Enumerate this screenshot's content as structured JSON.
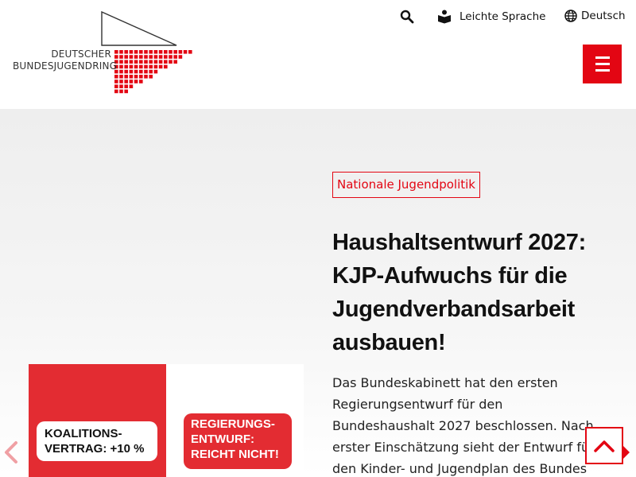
{
  "header": {
    "logo_line1": "DEUTSCHER",
    "logo_line2": "BUNDESJUGENDRING",
    "search_icon": "search-icon",
    "easy_language_label": "Leichte Sprache",
    "easy_language_icon": "book-reader-icon",
    "language_label": "Deutsch",
    "language_icon": "globe-icon",
    "menu_icon": "hamburger-icon"
  },
  "hero": {
    "category": "Nationale Jugendpolitik",
    "headline": "Haushaltsentwurf 2027: KJP-Aufwuchs für die Jugendverbandsarbeit ausbauen!",
    "teaser": "Das Bundeskabinett hat den ersten Regierungsentwurf für den Bundeshaushalt 2027 beschlossen. Nach erster Einschätzung sieht der Entwurf für den Kinder- und Jugendplan des Bundes",
    "image": {
      "sticker_left_line1": "KOALITIONS-",
      "sticker_left_line2": "VERTRAG: +10 %",
      "sticker_right_line1": "REGIERUNGS-",
      "sticker_right_line2": "ENTWURF:",
      "sticker_right_line3": "REICHT NICHT!"
    }
  },
  "controls": {
    "prev_icon": "chevron-left-icon",
    "next_icon": "chevron-right-icon",
    "back_to_top_icon": "chevron-up-icon"
  },
  "colors": {
    "brand_red": "#e30613",
    "image_red": "#e32c32",
    "text": "#111111"
  }
}
